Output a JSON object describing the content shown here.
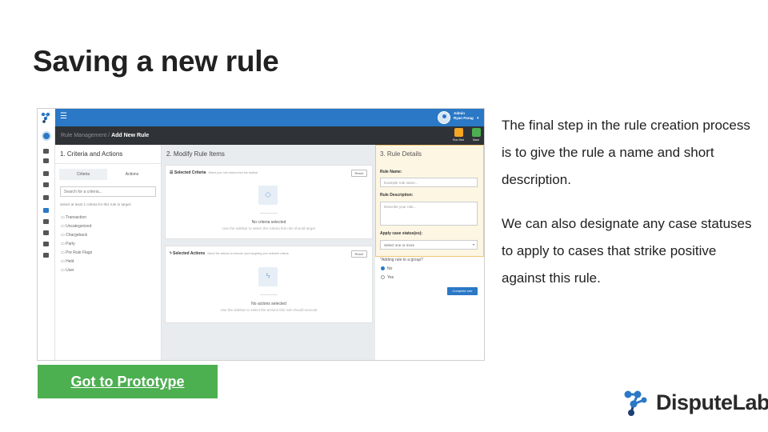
{
  "slide": {
    "title": "Saving a new rule",
    "description_1": "The final step in the rule creation process is to give the rule a name and short description.",
    "description_2": "We can also designate any case statuses to apply to cases that strike positive against this rule.",
    "prototype_button": "Got to Prototype",
    "brand_name": "DisputeLab"
  },
  "app": {
    "admin_role": "Admin",
    "admin_name": "Ryan Parag",
    "breadcrumb_root": "Rule Management",
    "breadcrumb_sep": "/",
    "breadcrumb_current": "Add New Rule",
    "run_test": "Run Test",
    "save": "Save",
    "col1": {
      "title": "1. Criteria and Actions",
      "tab_criteria": "Criteria",
      "tab_actions": "Actions",
      "search_placeholder": "Search for a criteria...",
      "help": "Select at least 1 criteria for this rule to target:",
      "items": [
        "Transaction",
        "Uncategorized",
        "Chargeback",
        "Party",
        "Pre Rule Flags",
        "Held",
        "User"
      ]
    },
    "col2": {
      "title": "2. Modify Rule Items",
      "criteria_title": "Selected Criteria",
      "criteria_hint": "Select your rule criteria from the sidebar",
      "reset": "Reset",
      "no_criteria": "No criteria selected",
      "no_criteria_sub": "Use the sidebar to select the criteria this rule should target",
      "actions_title": "Selected Actions",
      "actions_hint": "Select the actions to execute upon targeting your selected criteria",
      "no_actions": "No actions selected",
      "no_actions_sub": "Use the sidebar to select the actions this rule should execute"
    },
    "col3": {
      "title": "3. Rule Details",
      "name_label": "Rule Name:",
      "name_placeholder": "Example rule name...",
      "desc_label": "Rule Description:",
      "desc_placeholder": "Describe your rule...",
      "status_label": "Apply case status(es):",
      "status_value": "Select one or more",
      "group_label": "*Adding rule to a group?",
      "radio_no": "No",
      "radio_yes": "Yes",
      "complete": "Complete rule"
    }
  },
  "colors": {
    "topbar": "#2a78c6",
    "subbar": "#2f3337",
    "button_green": "#4caf50",
    "highlight": "#fdf6e3"
  }
}
